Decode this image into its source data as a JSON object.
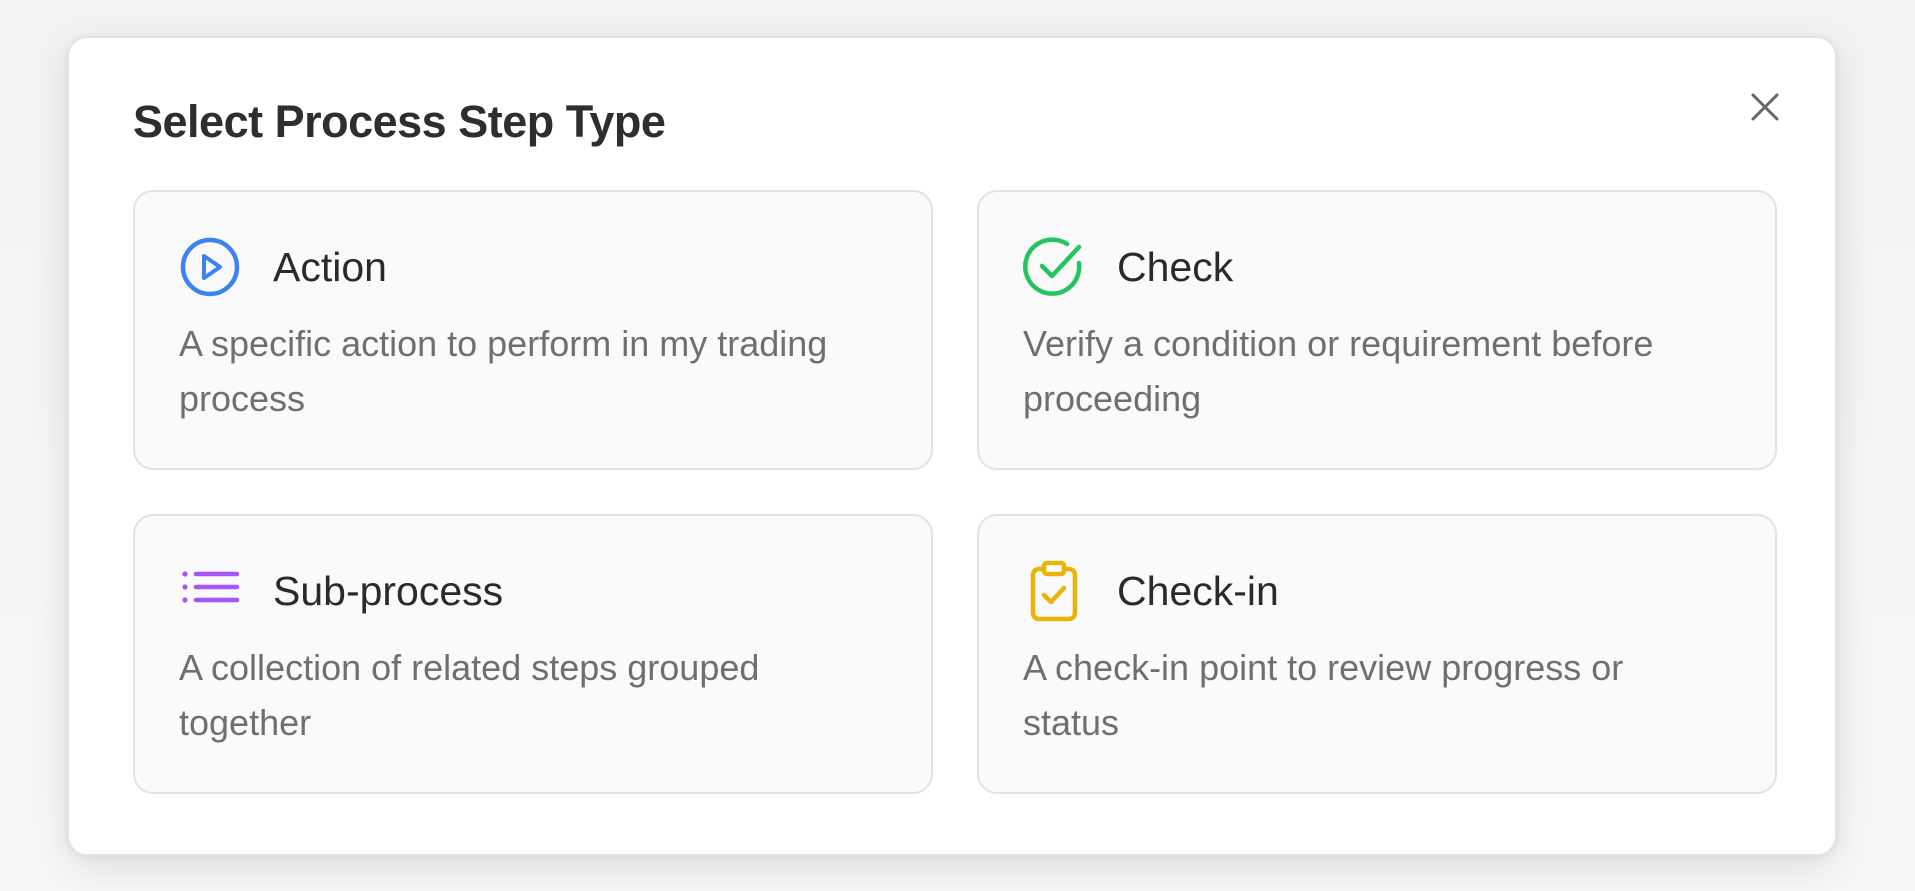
{
  "modal": {
    "title": "Select Process Step Type",
    "close_icon": "close-icon"
  },
  "options": [
    {
      "title": "Action",
      "description": "A specific action to perform in my trading process",
      "icon": "play-circle-icon",
      "color": "#3b82f6"
    },
    {
      "title": "Check",
      "description": "Verify a condition or requirement before proceeding",
      "icon": "check-circle-icon",
      "color": "#22c55e"
    },
    {
      "title": "Sub-process",
      "description": "A collection of related steps grouped together",
      "icon": "list-icon",
      "color": "#a855f7"
    },
    {
      "title": "Check-in",
      "description": "A check-in point to review progress or status",
      "icon": "clipboard-check-icon",
      "color": "#eab308"
    }
  ]
}
